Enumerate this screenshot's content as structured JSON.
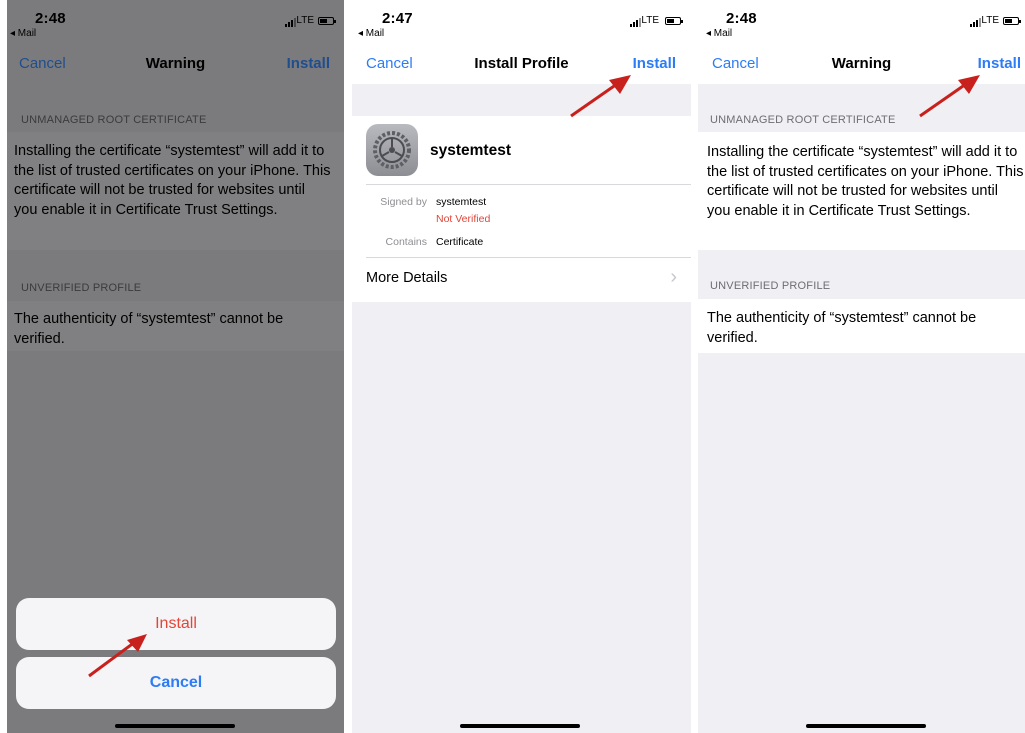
{
  "screens": [
    {
      "status": {
        "time": "2:48",
        "back": "◂ Mail",
        "network": "LTE"
      },
      "nav": {
        "cancel": "Cancel",
        "title": "Warning",
        "install": "Install"
      },
      "section1_header": "UNMANAGED ROOT CERTIFICATE",
      "section1_text": "Installing the certificate “systemtest” will add it to the list of trusted certificates on your iPhone. This certificate will not be trusted for websites until you enable it in Certificate Trust Settings.",
      "section2_header": "UNVERIFIED PROFILE",
      "section2_text": "The authenticity of “systemtest” cannot be verified.",
      "sheet": {
        "install": "Install",
        "cancel": "Cancel"
      }
    },
    {
      "status": {
        "time": "2:47",
        "back": "◂ Mail",
        "network": "LTE"
      },
      "nav": {
        "cancel": "Cancel",
        "title": "Install Profile",
        "install": "Install"
      },
      "profile_name": "systemtest",
      "signed_by_label": "Signed by",
      "signed_by_value": "systemtest",
      "verification": "Not Verified",
      "contains_label": "Contains",
      "contains_value": "Certificate",
      "more_details": "More Details",
      "chevron": "›"
    },
    {
      "status": {
        "time": "2:48",
        "back": "◂ Mail",
        "network": "LTE"
      },
      "nav": {
        "cancel": "Cancel",
        "title": "Warning",
        "install": "Install"
      },
      "section1_header": "UNMANAGED ROOT CERTIFICATE",
      "section1_text": "Installing the certificate “systemtest” will add it to the list of trusted certificates on your iPhone. This certificate will not be trusted for websites until you enable it in Certificate Trust Settings.",
      "section2_header": "UNVERIFIED PROFILE",
      "section2_text": "The authenticity of “systemtest” cannot be verified."
    }
  ],
  "colors": {
    "link": "#2c7cf6",
    "destructive": "#e0463a",
    "arrow": "#c8211d"
  },
  "icons": {
    "settings": "gear-icon",
    "arrow": "red-arrow-annotation"
  }
}
